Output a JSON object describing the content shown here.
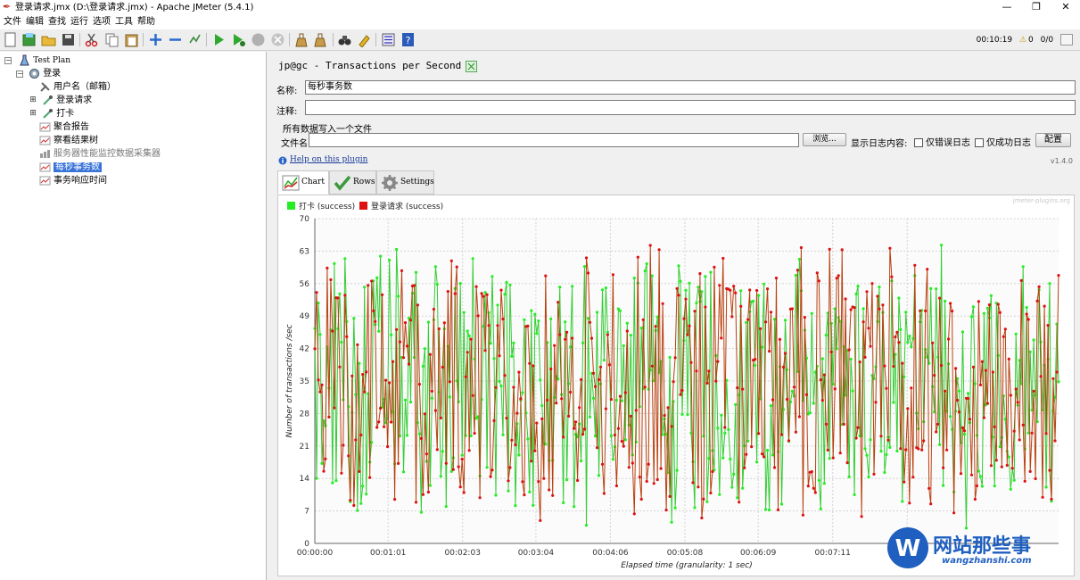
{
  "window": {
    "title": "登录请求.jmx (D:\\登录请求.jmx) - Apache JMeter (5.4.1)",
    "minimize": "—",
    "restore": "❐",
    "close": "✕"
  },
  "menu": [
    "文件",
    "编辑",
    "查找",
    "运行",
    "选项",
    "工具",
    "帮助"
  ],
  "status": {
    "elapsed": "00:10:19",
    "warnings": "0",
    "threads": "0/0"
  },
  "tree": {
    "root": "Test Plan",
    "group": "登录",
    "items": [
      {
        "label": "用户名（邮箱）",
        "icon": "config-wrench-icon"
      },
      {
        "label": "登录请求",
        "icon": "sampler-pipette-icon"
      },
      {
        "label": "打卡",
        "icon": "sampler-pipette-icon"
      },
      {
        "label": "聚合报告",
        "icon": "listener-chart-icon"
      },
      {
        "label": "察看结果树",
        "icon": "listener-chart-icon"
      },
      {
        "label": "服务器性能监控数据采集器",
        "icon": "listener-gray-icon"
      },
      {
        "label": "每秒事务数",
        "icon": "listener-chart-icon"
      },
      {
        "label": "事务响应时间",
        "icon": "listener-chart-icon"
      }
    ]
  },
  "panel": {
    "title": "jp@gc - Transactions per Second",
    "name_label": "名称:",
    "name_value": "每秒事务数",
    "comment_label": "注释:",
    "comment_value": "",
    "file_section": "所有数据写入一个文件",
    "filename_label": "文件名",
    "filename_value": "",
    "browse": "浏览...",
    "log_label": "显示日志内容:",
    "errors_only": "仅错误日志",
    "success_only": "仅成功日志",
    "configure": "配置",
    "help_link": "Help on this plugin",
    "version": "v1.4.0",
    "tabs": [
      "Chart",
      "Rows",
      "Settings"
    ]
  },
  "watermark": {
    "brand": "网站那些事",
    "url": "wangzhanshi.com",
    "logo_letter": "W",
    "chart_credit": "jmeter-plugins.org"
  },
  "chart_data": {
    "type": "line",
    "series": [
      {
        "name": "打卡 (success)",
        "color": "#22ee22"
      },
      {
        "name": "登录请求 (success)",
        "color": "#dd1111"
      }
    ],
    "xlabel": "Elapsed time (granularity: 1 sec)",
    "ylabel": "Number of transactions /sec",
    "ylim": [
      0,
      70
    ],
    "yticks": [
      "0",
      "7",
      "14",
      "21",
      "28",
      "35",
      "42",
      "49",
      "56",
      "63",
      "70"
    ],
    "xticks": [
      "00:00:00",
      "00:01:01",
      "00:02:03",
      "00:03:04",
      "00:04:06",
      "00:05:08",
      "00:06:09",
      "00:07:11",
      "00:08:13"
    ],
    "duration_seconds": 619,
    "grid": true,
    "legend": "top-left"
  }
}
